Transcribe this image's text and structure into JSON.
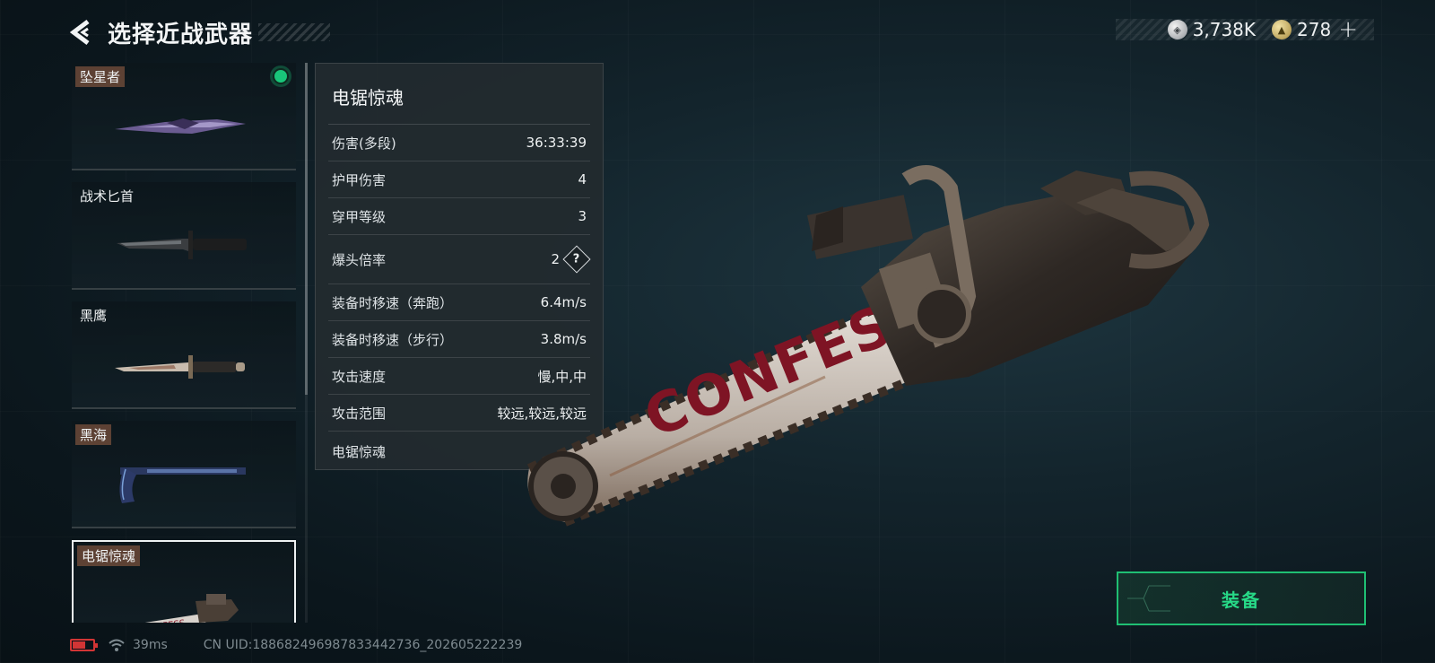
{
  "header": {
    "title": "选择近战武器"
  },
  "currency": {
    "silver_amount": "3,738K",
    "gold_amount": "278"
  },
  "weapons": [
    {
      "name": "坠星者",
      "equipped": true,
      "selected": false
    },
    {
      "name": "战术匕首",
      "equipped": false,
      "selected": false
    },
    {
      "name": "黑鹰",
      "equipped": false,
      "selected": false
    },
    {
      "name": "黑海",
      "equipped": false,
      "selected": false
    },
    {
      "name": "电锯惊魂",
      "equipped": false,
      "selected": true
    }
  ],
  "stats": {
    "title": "电锯惊魂",
    "rows": [
      {
        "label": "伤害(多段)",
        "value": "36:33:39"
      },
      {
        "label": "护甲伤害",
        "value": "4"
      },
      {
        "label": "穿甲等级",
        "value": "3"
      },
      {
        "label": "爆头倍率",
        "value": "2"
      },
      {
        "label": "装备时移速（奔跑）",
        "value": "6.4m/s"
      },
      {
        "label": "装备时移速（步行）",
        "value": "3.8m/s"
      },
      {
        "label": "攻击速度",
        "value": "慢,中,中"
      },
      {
        "label": "攻击范围",
        "value": "较远,较远,较远"
      }
    ],
    "footer": "电锯惊魂",
    "help_icon_text": "?"
  },
  "weapon_graffiti": "CONFESS",
  "equip_button": {
    "label": "装备"
  },
  "status_bar": {
    "ping": "39ms",
    "uid": "CN UID:1886824969878334427​36_202605222239"
  },
  "colors": {
    "accent_green": "#27d987",
    "equipped_dot": "#19c67a",
    "battery_red": "#d23535"
  }
}
